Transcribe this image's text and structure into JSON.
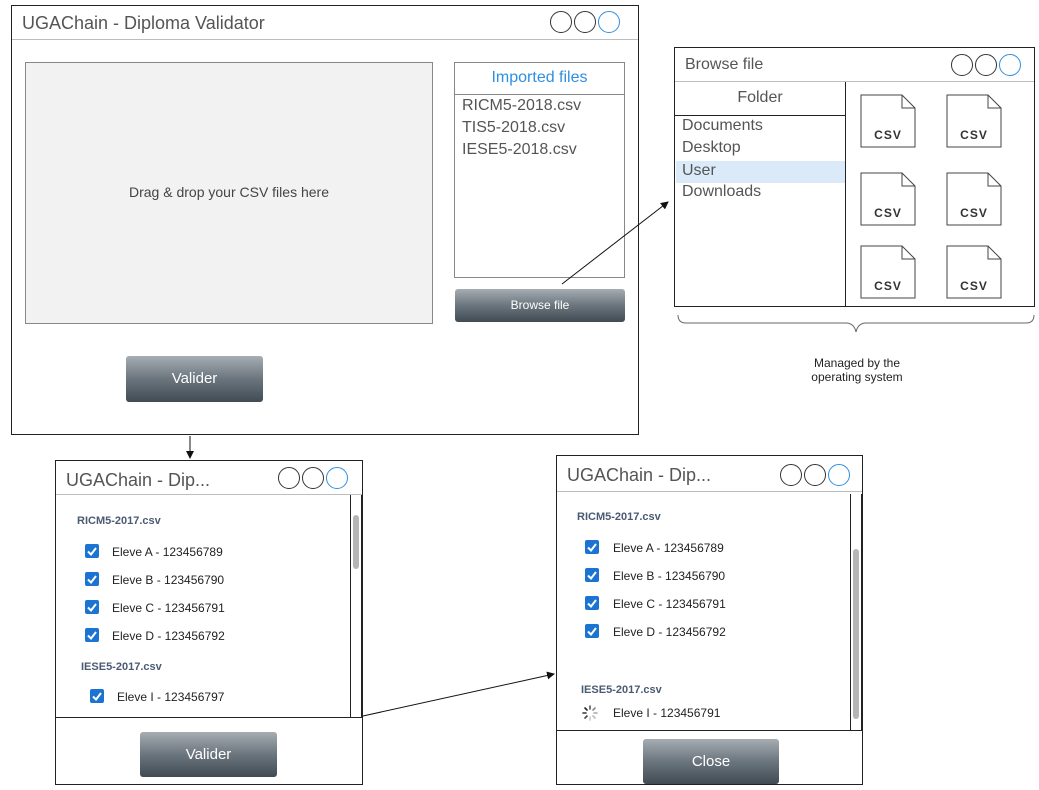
{
  "main_window": {
    "title": "UGAChain - Diploma Validator",
    "dropzone_text": "Drag & drop your CSV files here",
    "imported_header": "Imported files",
    "imported_files": [
      "RICM5-2018.csv",
      "TIS5-2018.csv",
      "IESE5-2018.csv"
    ],
    "browse_label": "Browse file",
    "valider_label": "Valider"
  },
  "browse_window": {
    "title": "Browse file",
    "folder_header": "Folder",
    "folders": [
      "Documents",
      "Desktop",
      "User",
      "Downloads"
    ],
    "selected_folder": "User",
    "file_icon_label": "CSV",
    "file_count": 6
  },
  "os_note": {
    "line1": "Managed by the",
    "line2": "operating system"
  },
  "left_window": {
    "title": "UGAChain - Dip...",
    "group1": {
      "name": "RICM5-2017.csv",
      "items": [
        "Eleve A - 123456789",
        "Eleve B - 123456790",
        "Eleve C - 123456791",
        "Eleve D - 123456792"
      ]
    },
    "group2": {
      "name": "IESE5-2017.csv",
      "items": [
        "Eleve I - 123456797"
      ]
    },
    "valider_label": "Valider"
  },
  "right_window": {
    "title": "UGAChain - Dip...",
    "group1": {
      "name": "RICM5-2017.csv",
      "items": [
        "Eleve A - 123456789",
        "Eleve B - 123456790",
        "Eleve C - 123456791",
        "Eleve D - 123456792"
      ]
    },
    "group2": {
      "name": "IESE5-2017.csv",
      "items": [
        "Eleve I - 123456791"
      ]
    },
    "close_label": "Close"
  },
  "colors": {
    "accent_blue": "#2f8fe0",
    "checkbox_blue": "#1b74d1",
    "selected_bg": "#dbeaf8",
    "button_dark": "#414b53"
  }
}
